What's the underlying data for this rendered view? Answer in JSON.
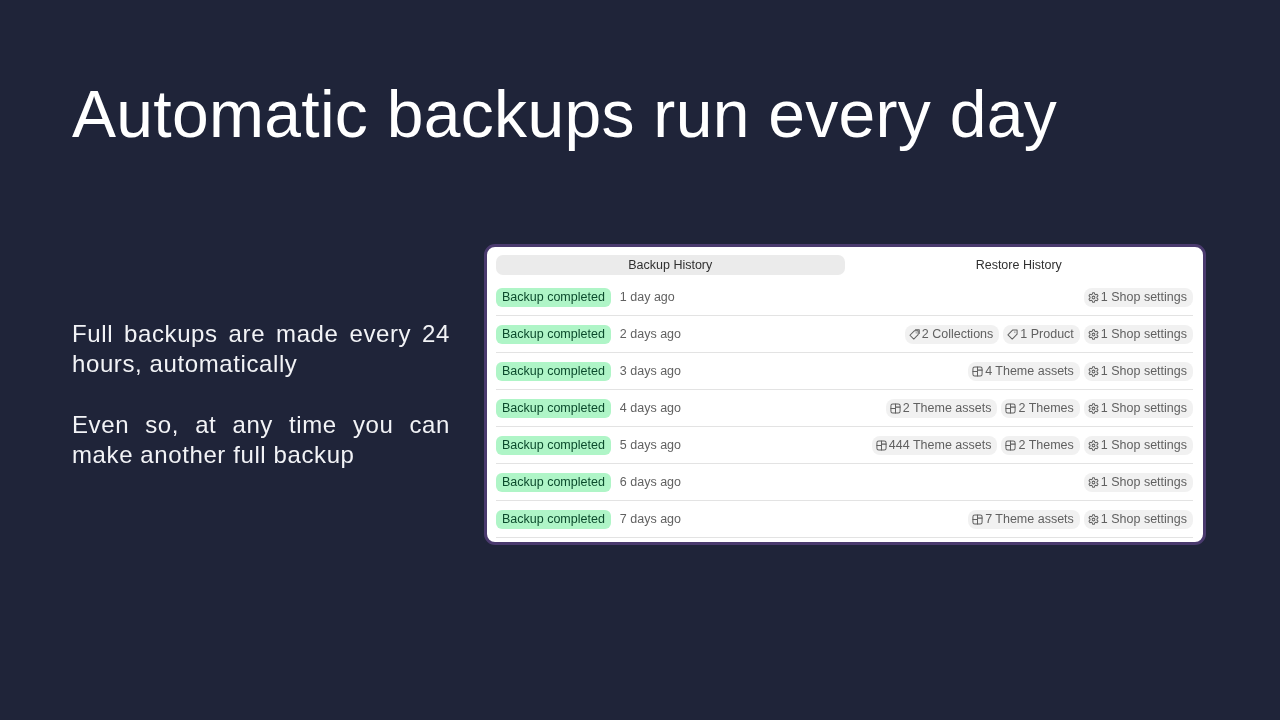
{
  "heading": "Automatic backups run every day",
  "paragraphs": [
    "Full backups are made every 24 hours, automatically",
    "Even so, at any time you can make another full backup"
  ],
  "panel": {
    "tabs": [
      {
        "label": "Backup History",
        "selected": true
      },
      {
        "label": "Restore History",
        "selected": false
      }
    ],
    "rows": [
      {
        "status": "Backup completed",
        "time": "1 day ago",
        "items": [
          {
            "kind": "settings",
            "label": "1 Shop settings"
          }
        ]
      },
      {
        "status": "Backup completed",
        "time": "2 days ago",
        "items": [
          {
            "kind": "collection",
            "label": "2 Collections"
          },
          {
            "kind": "product",
            "label": "1 Product"
          },
          {
            "kind": "settings",
            "label": "1 Shop settings"
          }
        ]
      },
      {
        "status": "Backup completed",
        "time": "3 days ago",
        "items": [
          {
            "kind": "theme",
            "label": "4 Theme assets"
          },
          {
            "kind": "settings",
            "label": "1 Shop settings"
          }
        ]
      },
      {
        "status": "Backup completed",
        "time": "4 days ago",
        "items": [
          {
            "kind": "theme",
            "label": "2 Theme assets"
          },
          {
            "kind": "theme",
            "label": "2 Themes"
          },
          {
            "kind": "settings",
            "label": "1 Shop settings"
          }
        ]
      },
      {
        "status": "Backup completed",
        "time": "5 days ago",
        "items": [
          {
            "kind": "theme",
            "label": "444 Theme assets"
          },
          {
            "kind": "theme",
            "label": "2 Themes"
          },
          {
            "kind": "settings",
            "label": "1 Shop settings"
          }
        ]
      },
      {
        "status": "Backup completed",
        "time": "6 days ago",
        "items": [
          {
            "kind": "settings",
            "label": "1 Shop settings"
          }
        ]
      },
      {
        "status": "Backup completed",
        "time": "7 days ago",
        "items": [
          {
            "kind": "theme",
            "label": "7 Theme assets"
          },
          {
            "kind": "settings",
            "label": "1 Shop settings"
          }
        ]
      }
    ]
  }
}
